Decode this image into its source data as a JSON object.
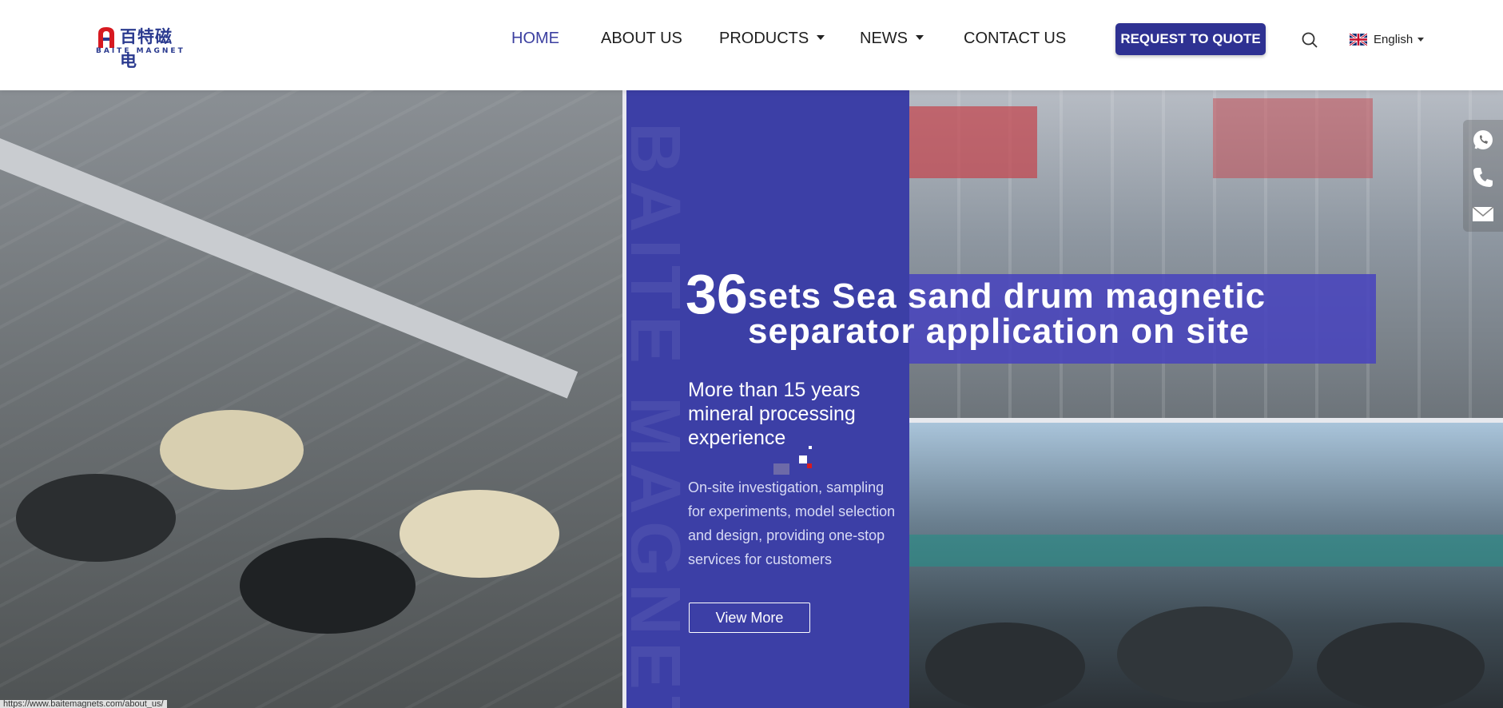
{
  "header": {
    "logo": {
      "cn": "百特磁电",
      "en": "BAITE MAGNET"
    },
    "nav": [
      {
        "label": "HOME",
        "active": true,
        "dropdown": false
      },
      {
        "label": "ABOUT US",
        "active": false,
        "dropdown": false
      },
      {
        "label": "PRODUCTS",
        "active": false,
        "dropdown": true
      },
      {
        "label": "NEWS",
        "active": false,
        "dropdown": true
      },
      {
        "label": "CONTACT US",
        "active": false,
        "dropdown": false
      }
    ],
    "quote_button": "REQUEST TO QUOTE",
    "search_icon": "search-icon",
    "language": {
      "label": "English",
      "flag": "uk-flag-icon"
    }
  },
  "hero": {
    "number": "36",
    "headline": "sets Sea sand drum magnetic separator application on site",
    "subheading": "More than 15 years mineral processing experience",
    "description": "On-site investigation, sampling for experiments, model selection and design, providing one-stop services for customers",
    "cta": "View More",
    "watermark": "BAITE MAGNETIC"
  },
  "contact_bar": [
    "whatsapp-icon",
    "phone-icon",
    "email-icon"
  ],
  "status_url": "https://www.baitemagnets.com/about_us/",
  "colors": {
    "brand": "#2e3192",
    "panel": "#3c3fa6",
    "accent_red": "#d71920"
  }
}
